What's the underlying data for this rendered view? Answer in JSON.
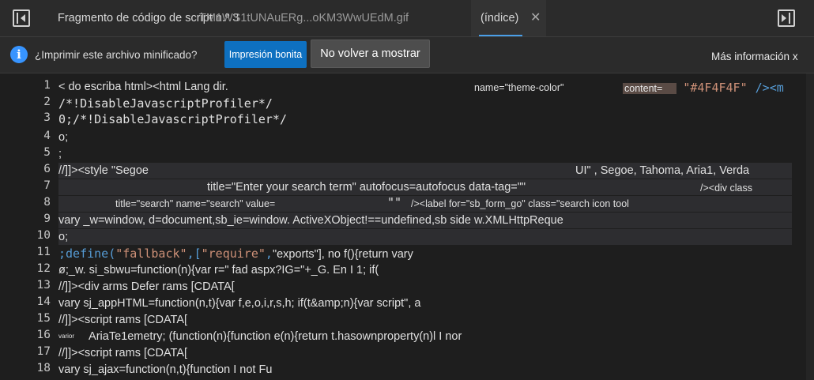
{
  "tabs": {
    "tab1_label": "Fragmento de código de script n.º 3",
    "tab2_label": "TM1WS1tUNAuERg...oKM3WwUEdM.gif",
    "tab3_label": "(índice)",
    "close_glyph": "✕"
  },
  "infobar": {
    "icon_glyph": "i",
    "message": "¿Imprimir este archivo minificado?",
    "primary_button": "Impresión bonita",
    "secondary_button": "No volver a mostrar",
    "more_info": "Más información",
    "close_glyph": "x"
  },
  "code": {
    "line_numbers": [
      "1",
      "2",
      "3",
      "4",
      "5",
      "6",
      "7",
      "8",
      "9",
      "10",
      "11",
      "12",
      "13",
      "14",
      "15",
      "16",
      "17",
      "18"
    ],
    "l1_a": "< do escriba html><html Lang dir.",
    "l1_b": "name=\"theme-color\"",
    "l1_c": "content=",
    "l1_d": "\"#4F4F4F\"",
    "l1_e": "/><m",
    "l2": "/*!DisableJavascriptProfiler*/",
    "l3": "0;/*!DisableJavascriptProfiler*/",
    "l4": "o;",
    "l5": ";",
    "l6_a": "//]]><style \"Segoe",
    "l6_b": "UI\" , Segoe, Tahoma, Aria1, Verda",
    "l7_a": "title=\"Enter your search term\" autofocus=autofocus data-tag=\"\"",
    "l7_b": "/><div class",
    "l8_a": "title=\"search\" name=\"search\" value=",
    "l8_b": "\"\"",
    "l8_c": "/><label for=\"sb_form_go\" class=\"search icon tool",
    "l9": "vary _w=window, d=document,sb_ie=window. ActiveXObject!==undefined,sb side w.XMLHttpReque",
    "l10": "o;",
    "l11_a": ";define(",
    "l11_b": "\"fallback\"",
    "l11_c": ",[",
    "l11_d": "\"require\"",
    "l11_e": ",",
    "l11_f": "\"exports\"], no f(){return vary",
    "l12": "ø;_w. si_sbwu=function(n){var r=\" fad aspx?IG=\"+_G. En I 1; if(",
    "l13": "//]]><div arms Defer rams [CDATA[",
    "l14": "vary sj_appHTML=function(n,t){var f,e,o,i,r,s,h; if(t&amp;n){var script\", a",
    "l15": "//]]><script rams [CDATA[",
    "l16_a": "varior",
    "l16_b": "AriaTe1emetry; (function(n){function e(n){return t.hasownproperty(n)l I nor",
    "l17": "//]]><script rams [CDATA[",
    "l18": "vary sj_ajax=function(n,t){function I not Fu"
  }
}
